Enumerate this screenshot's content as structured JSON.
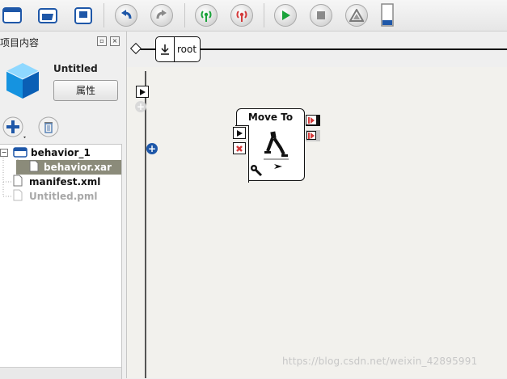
{
  "toolbar": {
    "buttons": [
      {
        "name": "new-window-icon"
      },
      {
        "name": "open-folder-icon"
      },
      {
        "name": "save-icon"
      },
      {
        "name": "undo-icon"
      },
      {
        "name": "redo-icon"
      },
      {
        "name": "connect-icon"
      },
      {
        "name": "disconnect-icon"
      },
      {
        "name": "play-icon"
      },
      {
        "name": "stop-icon"
      },
      {
        "name": "warning-icon"
      },
      {
        "name": "battery-icon"
      }
    ],
    "colors": {
      "green": "#1aa33a",
      "red": "#d43a3a",
      "blue": "#1e57a8"
    }
  },
  "panel": {
    "title": "项目内容",
    "project_name": "Untitled",
    "properties_label": "属性"
  },
  "tree": {
    "items": [
      {
        "label": "behavior_1",
        "type": "folder",
        "selected": false,
        "muted": false
      },
      {
        "label": "behavior.xar",
        "type": "file",
        "selected": true,
        "muted": false
      },
      {
        "label": "manifest.xml",
        "type": "file",
        "selected": false,
        "muted": false
      },
      {
        "label": "Untitled.pml",
        "type": "file",
        "selected": false,
        "muted": true
      }
    ]
  },
  "breadcrumb": {
    "root_label": "root"
  },
  "canvas": {
    "box": {
      "title": "Move To"
    }
  },
  "watermark": "https://blog.csdn.net/weixin_42895991"
}
